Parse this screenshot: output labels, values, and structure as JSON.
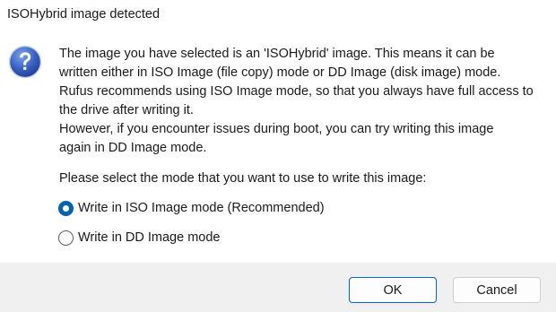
{
  "window": {
    "title": "ISOHybrid image detected"
  },
  "icon": {
    "name": "question-icon",
    "glyph": "?",
    "color_top": "#5b84d6",
    "color_bottom": "#1f3f9a"
  },
  "message": {
    "lines": [
      "The image you have selected is an 'ISOHybrid' image. This means it can be",
      "written either in ISO Image (file copy) mode or DD Image (disk image) mode.",
      "Rufus recommends using ISO Image mode, so that you always have full access to",
      "the drive after writing it.",
      "However, if you encounter issues during boot, you can try writing this image",
      "again in DD Image mode."
    ]
  },
  "prompt": "Please select the mode that you want to use to write this image:",
  "options": [
    {
      "label": "Write in ISO Image mode (Recommended)",
      "checked": true
    },
    {
      "label": "Write in DD Image mode",
      "checked": false
    }
  ],
  "buttons": {
    "ok_label": "OK",
    "cancel_label": "Cancel"
  },
  "colors": {
    "accent": "#0063b1",
    "footer_bg": "#f0f0f0"
  }
}
